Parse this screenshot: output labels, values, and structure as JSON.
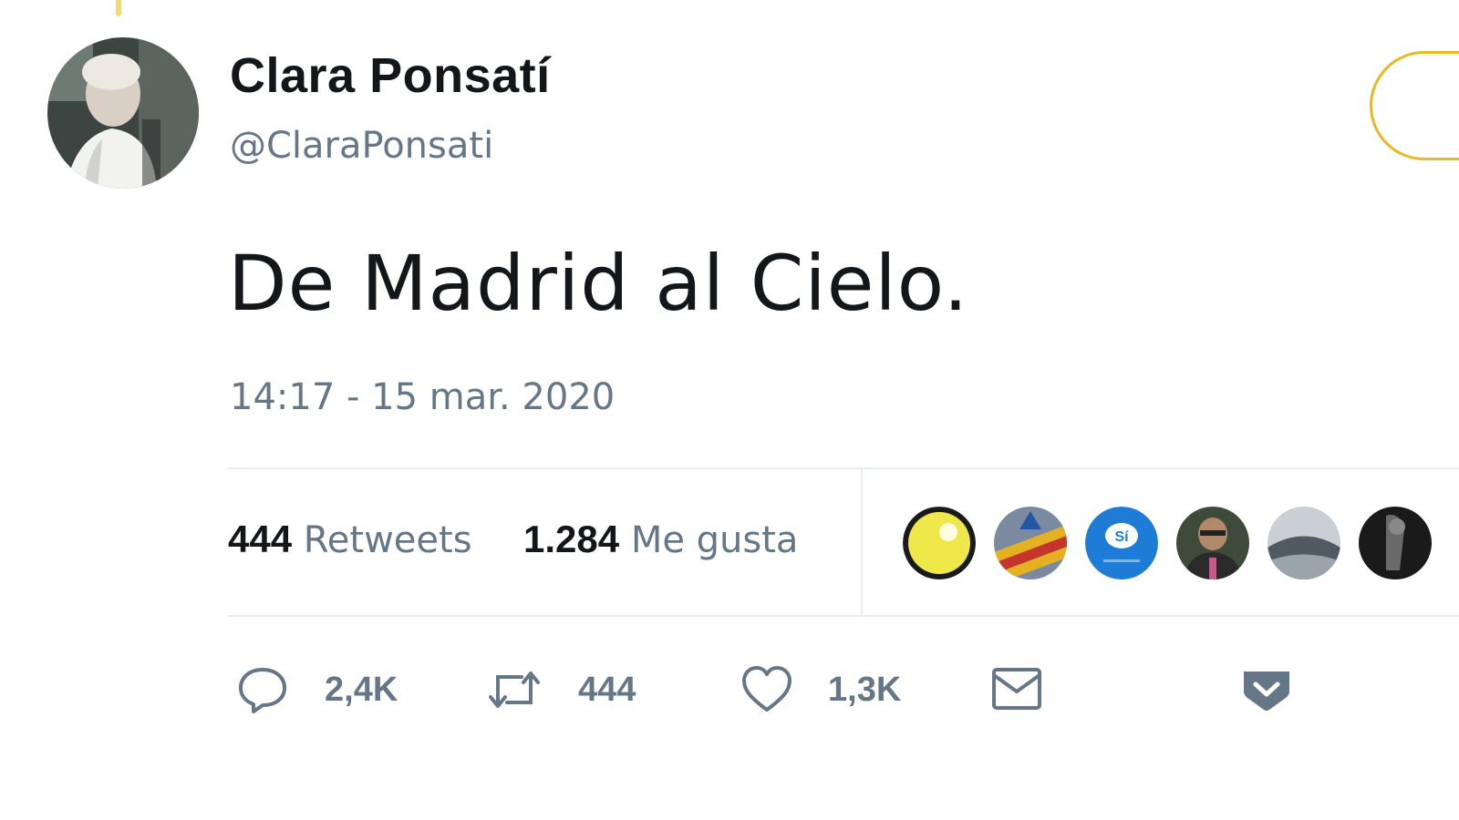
{
  "tweet": {
    "author": {
      "display_name": "Clara Ponsatí",
      "handle": "@ClaraPonsati"
    },
    "text": "De Madrid al Cielo.",
    "timestamp": "14:17 - 15 mar. 2020",
    "stats": {
      "retweets_count": "444",
      "retweets_label": "Retweets",
      "likes_count": "1.284",
      "likes_label": "Me gusta"
    },
    "actions": {
      "reply_count": "2,4K",
      "retweet_count": "444",
      "like_count": "1,3K"
    },
    "icons": {
      "reply": "reply-icon",
      "retweet": "retweet-icon",
      "like": "heart-icon",
      "dm": "envelope-icon",
      "more": "chevron-down-icon"
    }
  },
  "colors": {
    "text_primary": "#14171a",
    "text_secondary": "#657786",
    "divider": "#e6ecf0",
    "follow_border": "#e8b923"
  }
}
